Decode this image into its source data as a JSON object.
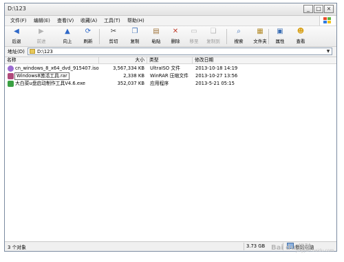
{
  "window": {
    "title": "D:\\123"
  },
  "titlebar_buttons": [
    "_",
    "□",
    "×"
  ],
  "menu": [
    "文件(F)",
    "编辑(E)",
    "查看(V)",
    "收藏(A)",
    "工具(T)",
    "帮助(H)"
  ],
  "toolbar": {
    "back": "后退",
    "forward": "前进",
    "up": "向上",
    "refresh": "刷新",
    "cut": "剪切",
    "copy": "复制",
    "paste": "粘贴",
    "delete": "删除",
    "move_to": "移至",
    "copy_to": "复制到",
    "search": "搜索",
    "folders": "文件夹",
    "properties": "属性",
    "views": "查看"
  },
  "address": {
    "label": "地址(D)",
    "value": "D:\\123"
  },
  "columns": {
    "name": "名称",
    "size": "大小",
    "type": "类型",
    "modified": "修改日期"
  },
  "files": [
    {
      "name": "cn_windows_8_x64_dvd_915407.iso",
      "size": "3,567,334 KB",
      "type": "UltraISO 文件",
      "modified": "2013-10-18 14:19",
      "icon": "iso-icon",
      "color": "#9b6bd1"
    },
    {
      "name": "Windows8激活工具.rar",
      "size": "2,338 KB",
      "type": "WinRAR 压缩文件",
      "modified": "2013-10-27 13:56",
      "icon": "rar-icon",
      "color": "#b04a7a"
    },
    {
      "name": "大白菜u盘启动制作工具V4.6.exe",
      "size": "352,037 KB",
      "type": "应用程序",
      "modified": "2013-5-21 05:15",
      "icon": "exe-icon",
      "color": "#3aa043"
    }
  ],
  "status": {
    "objects": "3 个对象",
    "size": "3.73 GB",
    "computer": "我的电脑"
  },
  "watermark": {
    "brand": "Bai du 经验",
    "sub": "jingyan.baidu.com"
  }
}
